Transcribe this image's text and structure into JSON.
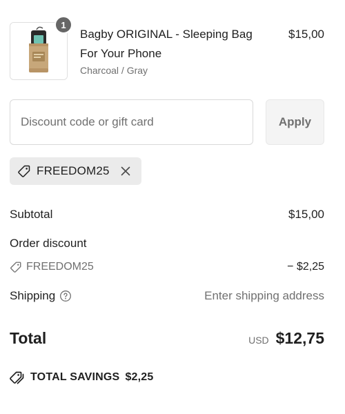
{
  "product": {
    "quantity": "1",
    "title": "Bagby ORIGINAL - Sleeping Bag For Your Phone",
    "variant": "Charcoal / Gray",
    "price": "$15,00",
    "image_icon": "product-thumbnail"
  },
  "discount": {
    "placeholder": "Discount code or gift card",
    "value": "",
    "apply_label": "Apply",
    "applied_code": "FREEDOM25",
    "tag_icon": "tag-icon",
    "remove_icon": "close-icon"
  },
  "summary": {
    "subtotal_label": "Subtotal",
    "subtotal_value": "$15,00",
    "order_discount_label": "Order discount",
    "discount_code": "FREEDOM25",
    "discount_value": "− $2,25",
    "shipping_label": "Shipping",
    "shipping_value": "Enter shipping address",
    "shipping_info_icon": "question-circle-icon"
  },
  "total": {
    "label": "Total",
    "currency": "USD",
    "amount": "$12,75"
  },
  "savings": {
    "label": "TOTAL SAVINGS",
    "amount": "$2,25",
    "icon": "tags-icon"
  },
  "colors": {
    "text": "#1f1f1f",
    "muted": "#707070",
    "badge": "#666666",
    "tag_bg": "#ebebeb",
    "border": "#d9d9d9"
  }
}
